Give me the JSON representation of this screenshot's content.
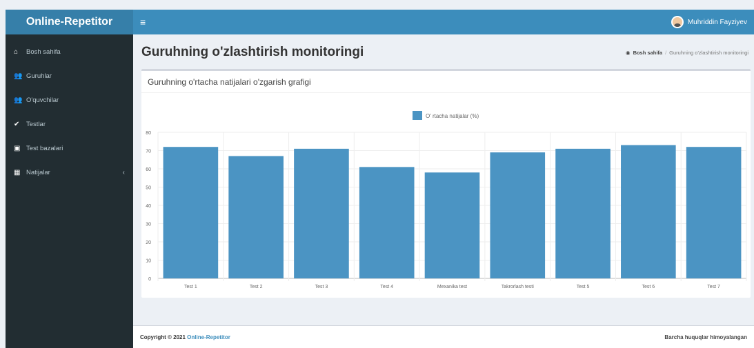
{
  "brand": "Online-Repetitor",
  "user": {
    "name": "Muhriddin Fayziyev"
  },
  "sidebar": {
    "items": [
      {
        "label": "Bosh sahifa",
        "icon": "home-icon"
      },
      {
        "label": "Guruhlar",
        "icon": "users-icon"
      },
      {
        "label": "O'quvchilar",
        "icon": "users-icon"
      },
      {
        "label": "Testlar",
        "icon": "check-icon"
      },
      {
        "label": "Test bazalari",
        "icon": "database-icon"
      },
      {
        "label": "Natijalar",
        "icon": "table-icon"
      }
    ]
  },
  "header": {
    "title": "Guruhning o'zlashtirish monitoringi",
    "breadcrumb_home": "Bosh sahifa",
    "breadcrumb_current": "Guruhning o'zlashtirish monitoringi"
  },
  "box": {
    "title": "Guruhning o'rtacha natijalari o'zgarish grafigi"
  },
  "footer": {
    "copyright_prefix": "Copyright © 2021",
    "copyright_brand": "Online-Repetitor",
    "rights": "Barcha huquqlar himoyalangan"
  },
  "colors": {
    "bar": "#4b94c3",
    "header": "#3c8dbc",
    "sidebar": "#222d32"
  },
  "chart_data": {
    "type": "bar",
    "categories": [
      "Test 1",
      "Test 2",
      "Test 3",
      "Test 4",
      "Mexanika test",
      "Takrorlash testi",
      "Test 5",
      "Test 6",
      "Test 7"
    ],
    "series": [
      {
        "name": "O' rtacha natijalar (%)",
        "values": [
          72,
          67,
          71,
          61,
          58,
          69,
          71,
          73,
          72
        ]
      }
    ],
    "ylim": [
      0,
      80
    ],
    "yticks": [
      0,
      10,
      20,
      30,
      40,
      50,
      60,
      70,
      80
    ],
    "legend": "top-center",
    "grid": true
  }
}
